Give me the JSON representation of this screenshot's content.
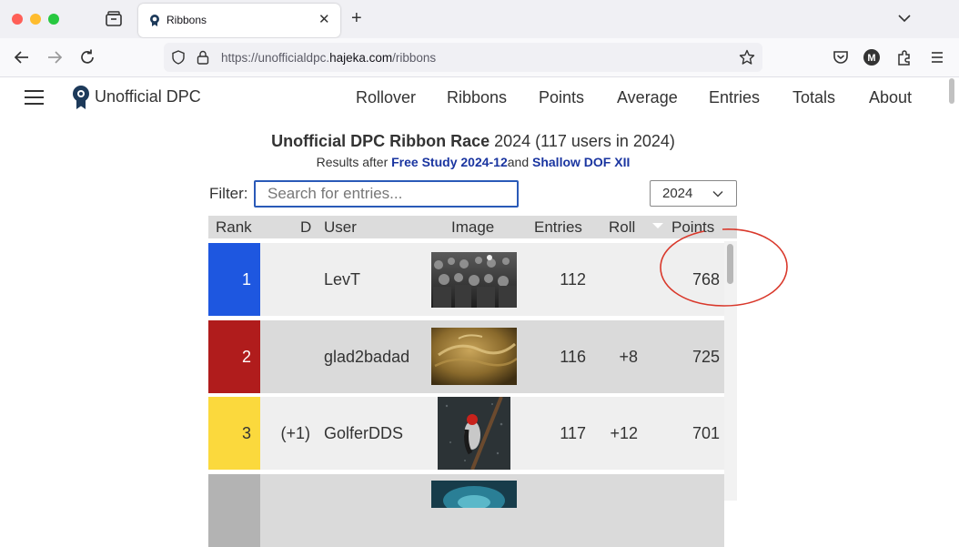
{
  "browser": {
    "tab_title": "Ribbons",
    "url_prefix": "https://unofficialdpc.",
    "url_domain": "hajeka.com",
    "url_path": "/ribbons",
    "colors": {
      "close": "#ff5f57",
      "minimize": "#febc2e",
      "zoom": "#28c840"
    }
  },
  "site": {
    "logo_text": "Unofficial DPC",
    "nav": [
      "Rollover",
      "Ribbons",
      "Points",
      "Average",
      "Entries",
      "Totals",
      "About"
    ]
  },
  "page": {
    "title_bold": "Unofficial DPC Ribbon Race",
    "title_rest": " 2024 (117 users in 2024)",
    "sub_prefix": "Results after ",
    "sub_link1": "Free Study 2024-12",
    "sub_mid": "and ",
    "sub_link2": "Shallow DOF XII",
    "filter_label": "Filter:",
    "filter_placeholder": "Search for entries...",
    "year_value": "2024"
  },
  "table": {
    "headers": {
      "rank": "Rank",
      "d": "D",
      "user": "User",
      "image": "Image",
      "entries": "Entries",
      "roll": "Roll",
      "points": "Points"
    },
    "rows": [
      {
        "rank": "1",
        "d": "",
        "user": "LevT",
        "entries": "112",
        "roll": "",
        "points": "768",
        "rank_color": "#1e57e0",
        "bg": "#efefef",
        "image": "crowd-photo"
      },
      {
        "rank": "2",
        "d": "",
        "user": "glad2badad",
        "entries": "116",
        "roll": "+8",
        "points": "725",
        "rank_color": "#b01c1c",
        "bg": "#dadada",
        "image": "sand-photo"
      },
      {
        "rank": "3",
        "d": "(+1)",
        "user": "GolferDDS",
        "entries": "117",
        "roll": "+12",
        "points": "701",
        "rank_color": "#fbd93d",
        "bg": "#efefef",
        "image": "woodpecker-photo"
      },
      {
        "rank": "",
        "d": "",
        "user": "",
        "entries": "",
        "roll": "",
        "points": "",
        "rank_color": "#b3b3b3",
        "bg": "#dadada",
        "image": "teal-photo"
      }
    ]
  }
}
